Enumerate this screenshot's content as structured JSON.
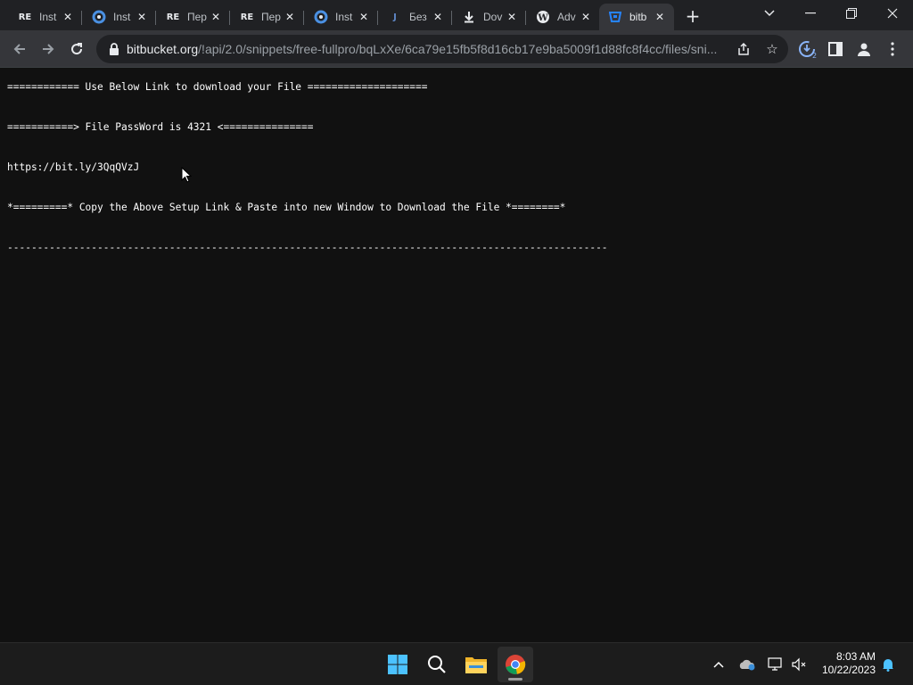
{
  "browser": {
    "tabs": [
      {
        "title": "Inst",
        "icon": "re-logo-icon",
        "active": false
      },
      {
        "title": "Inst",
        "icon": "blue-swirl-icon",
        "active": false
      },
      {
        "title": "Пер",
        "icon": "re-logo-icon",
        "active": false
      },
      {
        "title": "Пер",
        "icon": "re-logo-icon",
        "active": false
      },
      {
        "title": "Inst",
        "icon": "blue-swirl-icon",
        "active": false
      },
      {
        "title": "Без",
        "icon": "j-logo-icon",
        "active": false
      },
      {
        "title": "Dov",
        "icon": "download-icon",
        "active": false
      },
      {
        "title": "Adv",
        "icon": "wordpress-icon",
        "active": false
      },
      {
        "title": "bitb",
        "icon": "bitbucket-icon",
        "active": true
      }
    ],
    "url_host": "bitbucket.org",
    "url_path": "/!api/2.0/snippets/free-fullpro/bqLxXe/6ca79e15fb5f8d16cb17e9ba5009f1d88fc8f4cc/files/sni...",
    "download_badge": "2"
  },
  "content": {
    "lines": [
      "============ Use Below Link to download your File ====================",
      "===========> File PassWord is 4321 <===============",
      "https://bit.ly/3QqQVzJ",
      "*=========* Copy the Above Setup Link & Paste into new Window to Download the File *========*",
      "----------------------------------------------------------------------------------------------------"
    ]
  },
  "taskbar": {
    "time": "8:03 AM",
    "date": "10/22/2023"
  },
  "colors": {
    "page_bg": "#111111",
    "tabstrip_bg": "#202124",
    "toolbar_bg": "#35363a",
    "omnibox_bg": "#202124",
    "taskbar_bg": "#1c1c1c",
    "text": "#ffffff"
  }
}
